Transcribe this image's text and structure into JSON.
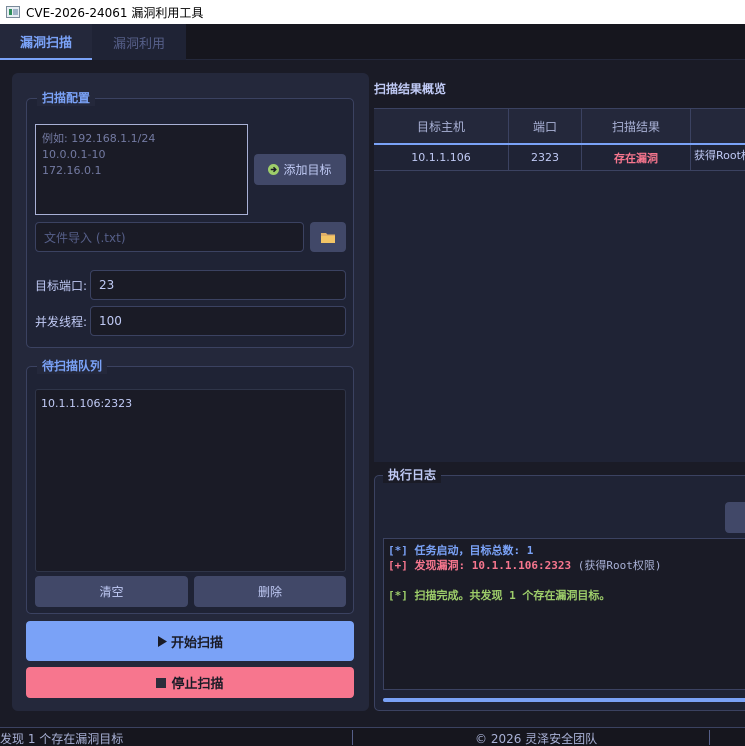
{
  "window": {
    "title": "CVE-2026-24061 漏洞利用工具"
  },
  "tabs": [
    {
      "label": "漏洞扫描",
      "active": true
    },
    {
      "label": "漏洞利用",
      "active": false
    }
  ],
  "scan_config": {
    "title": "扫描配置",
    "targets_placeholder": "例如: 192.168.1.1/24\n10.0.0.1-10\n172.16.0.1",
    "add_target_label": "添加目标",
    "file_import_placeholder": "文件导入 (.txt)",
    "port_label": "目标端口:",
    "port_value": "23",
    "threads_label": "并发线程:",
    "threads_value": "100"
  },
  "queue": {
    "title": "待扫描队列",
    "items": [
      "10.1.1.106:2323"
    ],
    "clear_label": "清空",
    "delete_label": "删除"
  },
  "actions": {
    "start_label": "开始扫描",
    "stop_label": "停止扫描"
  },
  "results": {
    "title": "扫描结果概览",
    "columns": [
      "目标主机",
      "端口",
      "扫描结果",
      ""
    ],
    "rows": [
      {
        "host": "10.1.1.106",
        "port": "2323",
        "result": "存在漏洞",
        "detail": "获得Root权限"
      }
    ]
  },
  "log": {
    "title": "执行日志",
    "lines": [
      {
        "prefix": "[*] ",
        "text": "任务启动，目标总数: 1",
        "suffix": ""
      },
      {
        "prefix": "[+] ",
        "text": "发现漏洞: 10.1.1.106:2323",
        "suffix": " (获得Root权限)"
      },
      {
        "prefix": "",
        "text": "",
        "suffix": ""
      },
      {
        "prefix": "[*] ",
        "text": "扫描完成。共发现 1 个存在漏洞目标。",
        "suffix": ""
      }
    ]
  },
  "status_bar": {
    "left": "发现 1 个存在漏洞目标",
    "center": "© 2026 灵泽安全团队"
  },
  "colors": {
    "accent": "#7aa2f7",
    "danger": "#f7768e",
    "success": "#9ece6a",
    "background": "#1a1b26"
  },
  "icons": {
    "add_target": "arrow-right-circle-icon",
    "file_browse": "folder-icon",
    "start": "play-icon",
    "stop": "stop-icon"
  }
}
